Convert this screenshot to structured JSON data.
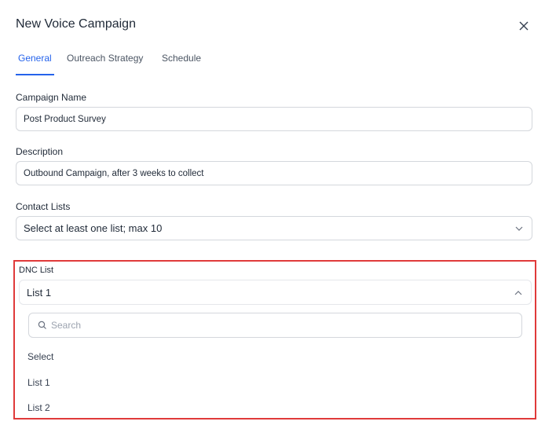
{
  "dialog": {
    "title": "New Voice Campaign"
  },
  "tabs": [
    {
      "label": "General",
      "active": true
    },
    {
      "label": "Outreach Strategy",
      "active": false
    },
    {
      "label": "Schedule",
      "active": false
    }
  ],
  "form": {
    "campaign_name": {
      "label": "Campaign Name",
      "value": "Post Product Survey"
    },
    "description": {
      "label": "Description",
      "value": "Outbound Campaign, after 3 weeks to collect"
    },
    "contact_lists": {
      "label": "Contact Lists",
      "placeholder": "Select at least one list; max 10"
    },
    "dnc_list": {
      "label": "DNC List",
      "value": "List 1",
      "search_placeholder": "Search",
      "options": [
        "Select",
        "List 1",
        "List 2"
      ]
    }
  },
  "colors": {
    "accent": "#2563eb",
    "highlight": "#e03a3a"
  },
  "icons": {
    "close": "close-icon",
    "chevron_down": "chevron-down-icon",
    "chevron_up": "chevron-up-icon",
    "search": "search-icon"
  }
}
